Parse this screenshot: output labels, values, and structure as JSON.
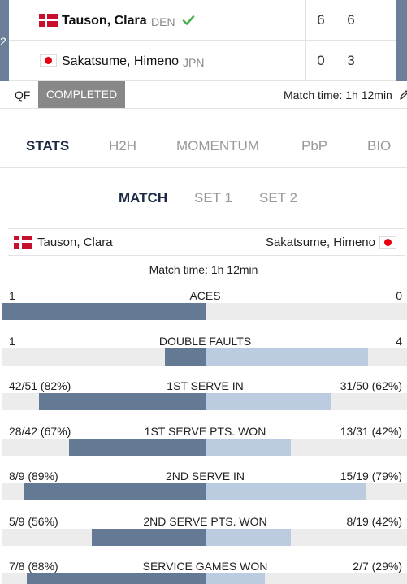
{
  "score": {
    "seed_marker": "2",
    "players": [
      {
        "name": "Tauson, Clara",
        "country": "DEN",
        "flag": "flag-denmark-icon",
        "winner": true,
        "sets": [
          "6",
          "6"
        ]
      },
      {
        "name": "Sakatsume, Himeno",
        "country": "JPN",
        "flag": "flag-japan-icon",
        "winner": false,
        "sets": [
          "0",
          "3"
        ]
      }
    ]
  },
  "status": {
    "round": "QF",
    "state": "COMPLETED",
    "match_time": "Match time: 1h 12min"
  },
  "tabs": [
    {
      "label": "STATS",
      "active": true
    },
    {
      "label": "H2H",
      "active": false
    },
    {
      "label": "MOMENTUM",
      "active": false
    },
    {
      "label": "PbP",
      "active": false
    },
    {
      "label": "BIO",
      "active": false
    }
  ],
  "subtabs": [
    {
      "label": "MATCH",
      "active": true
    },
    {
      "label": "SET 1",
      "active": false
    },
    {
      "label": "SET 2",
      "active": false
    }
  ],
  "players_line": {
    "left": "Tauson, Clara",
    "right": "Sakatsume, Himeno"
  },
  "match_time": "Match time: 1h 12min",
  "stats": [
    {
      "label": "ACES",
      "left": "1",
      "right": "0",
      "left_share": 1.0,
      "right_share": 0.0
    },
    {
      "label": "DOUBLE FAULTS",
      "left": "1",
      "right": "4",
      "left_share": 0.2,
      "right_share": 0.8
    },
    {
      "label": "1ST SERVE IN",
      "left": "42/51 (82%)",
      "right": "31/50 (62%)",
      "left_share": 0.82,
      "right_share": 0.62
    },
    {
      "label": "1ST SERVE PTS. WON",
      "left": "28/42 (67%)",
      "right": "13/31 (42%)",
      "left_share": 0.67,
      "right_share": 0.42
    },
    {
      "label": "2ND SERVE IN",
      "left": "8/9 (89%)",
      "right": "15/19 (79%)",
      "left_share": 0.89,
      "right_share": 0.79
    },
    {
      "label": "2ND SERVE PTS. WON",
      "left": "5/9 (56%)",
      "right": "8/19 (42%)",
      "left_share": 0.56,
      "right_share": 0.42
    },
    {
      "label": "SERVICE GAMES WON",
      "left": "7/8 (88%)",
      "right": "2/7 (29%)",
      "left_share": 0.88,
      "right_share": 0.29
    }
  ],
  "colors": {
    "left_bar": "#647a94",
    "right_bar": "#bccce0",
    "track": "#ececec",
    "accent": "#6b7f9a",
    "winner_check": "#4caf50"
  }
}
